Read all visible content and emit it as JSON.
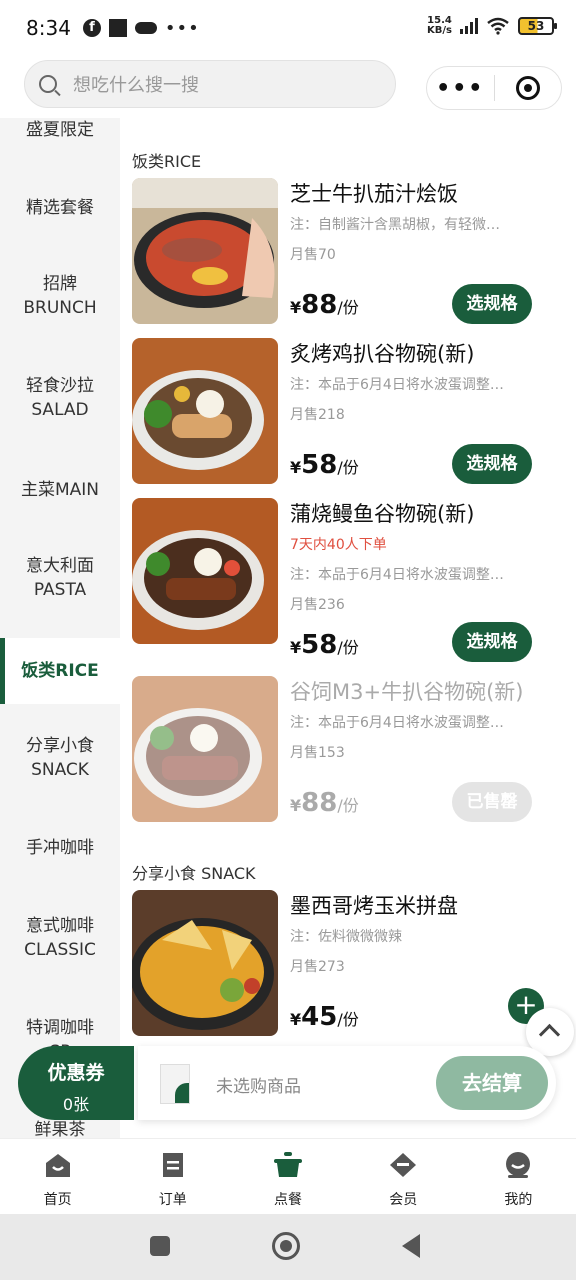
{
  "status_bar": {
    "time": "8:34",
    "net_speed_value": "15.4",
    "net_speed_unit": "KB/s",
    "battery": "53",
    "icons": [
      "facebook-icon",
      "square-notification-icon",
      "cloud-icon",
      "more-dots-icon",
      "signal-icon",
      "wifi-icon",
      "battery-icon"
    ]
  },
  "header": {
    "search_placeholder": "想吃什么搜一搜",
    "capsule_more": "•••"
  },
  "sidebar": {
    "items": [
      {
        "label": "盛夏限定"
      },
      {
        "label": "精选套餐"
      },
      {
        "label": "招牌",
        "sub": "BRUNCH"
      },
      {
        "label": "轻食沙拉",
        "sub": "SALAD"
      },
      {
        "label": "主菜MAIN"
      },
      {
        "label": "意大利面",
        "sub": "PASTA"
      },
      {
        "label": "饭类RICE",
        "active": true
      },
      {
        "label": "分享小食",
        "sub": "SNACK"
      },
      {
        "label": "手冲咖啡"
      },
      {
        "label": "意式咖啡",
        "sub": "CLASSIC"
      },
      {
        "label": "特调咖啡",
        "sub": "SP"
      },
      {
        "label": "鲜果茶"
      }
    ]
  },
  "sections": [
    {
      "title": "饭类RICE",
      "items": [
        {
          "name": "芝士牛扒茄汁烩饭",
          "note": "注：自制酱汁含黑胡椒，有轻微…",
          "sold": "月售70",
          "currency": "¥",
          "price": "88",
          "unit": "/份",
          "action": "选规格"
        },
        {
          "name": "炙烤鸡扒谷物碗(新)",
          "note": "注：本品于6月4日将水波蛋调整…",
          "sold": "月售218",
          "currency": "¥",
          "price": "58",
          "unit": "/份",
          "action": "选规格"
        },
        {
          "name": "蒲烧鳗鱼谷物碗(新)",
          "promo": "7天内40人下单",
          "note": "注：本品于6月4日将水波蛋调整…",
          "sold": "月售236",
          "currency": "¥",
          "price": "58",
          "unit": "/份",
          "action": "选规格"
        },
        {
          "name": "谷饲M3+牛扒谷物碗(新)",
          "note": "注：本品于6月4日将水波蛋调整…",
          "sold": "月售153",
          "currency": "¥",
          "price": "88",
          "unit": "/份",
          "action": "已售罄"
        }
      ]
    },
    {
      "title": "分享小食 SNACK",
      "items": [
        {
          "name": "墨西哥烤玉米拼盘",
          "note": "注：佐料微微微辣",
          "sold": "月售273",
          "currency": "¥",
          "price": "45",
          "unit": "/份",
          "action": "+"
        }
      ]
    }
  ],
  "cart": {
    "coupon_title": "优惠券",
    "coupon_count": "0张",
    "empty_text": "未选购商品",
    "checkout": "去结算"
  },
  "tabbar": {
    "tabs": [
      {
        "label": "首页",
        "icon": "home-icon"
      },
      {
        "label": "订单",
        "icon": "order-icon"
      },
      {
        "label": "点餐",
        "icon": "pot-icon",
        "active": true
      },
      {
        "label": "会员",
        "icon": "member-icon"
      },
      {
        "label": "我的",
        "icon": "profile-icon"
      }
    ]
  },
  "colors": {
    "brand_green": "#1a5d3c",
    "checkout_disabled": "#8fb9a1",
    "promo_red": "#e05040"
  }
}
